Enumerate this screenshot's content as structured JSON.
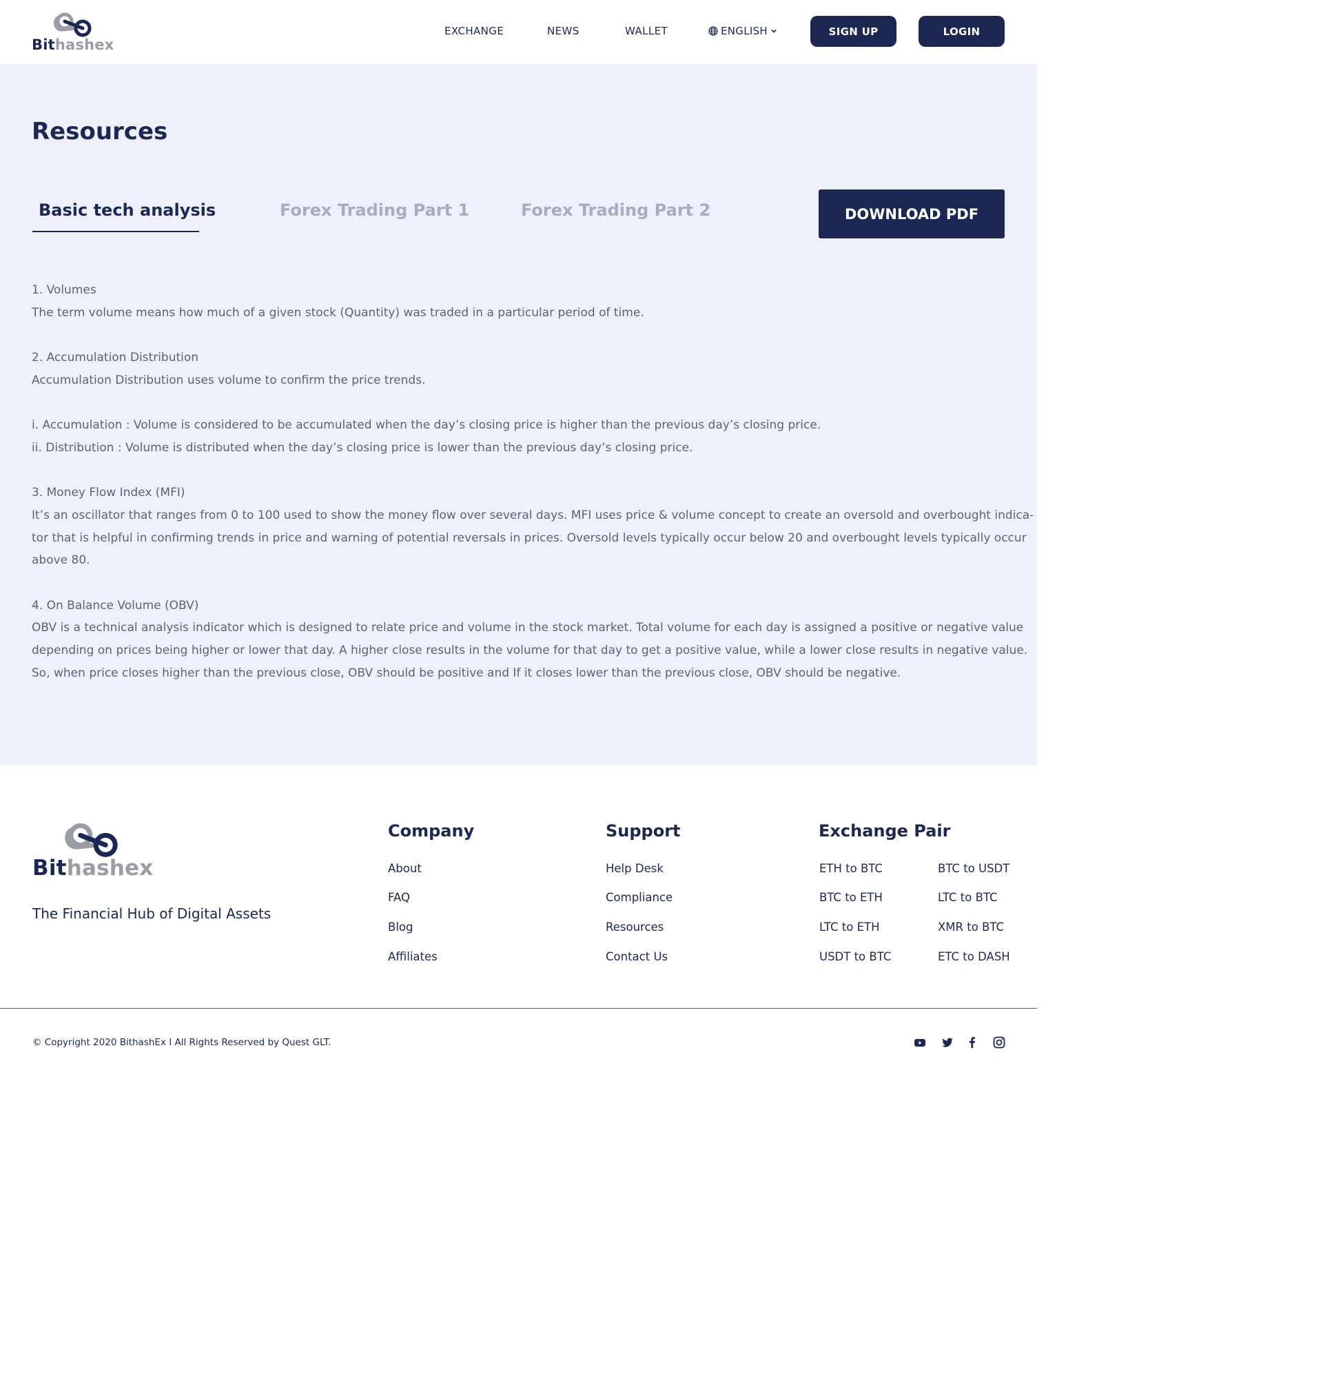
{
  "header": {
    "logo": {
      "part1": "Bit",
      "part2": "hashex"
    },
    "nav": [
      "EXCHANGE",
      "NEWS",
      "WALLET"
    ],
    "language": "ENGLISH",
    "signup_label": "SIGN UP",
    "login_label": "LOGIN"
  },
  "main": {
    "title": "Resources",
    "tabs": [
      "Basic tech analysis",
      "Forex Trading Part 1",
      "Forex Trading Part 2"
    ],
    "download_label": "DOWNLOAD PDF",
    "content": [
      "1. Volumes",
      "The term volume means how much of a given stock (Quantity) was traded in a particular period of time.",
      "",
      "2. Accumulation Distribution",
      "Accumulation Distribution uses volume to confirm the price trends.",
      "",
      "i. Accumulation : Volume is considered to be accumulated when the day’s closing price is higher than the previous day’s closing price.",
      "ii. Distribution : Volume is distributed when the day’s closing price is lower than the previous day’s closing price.",
      "",
      "3. Money Flow Index (MFI)",
      "It’s an oscillator that ranges from 0 to 100 used to show the money flow over several days. MFI uses price & volume concept to create an oversold and overbought indica-",
      "tor that is helpful in confirming trends in price and warning of potential reversals in prices. Oversold levels typically occur below 20 and overbought levels typically occur",
      "above 80.",
      "",
      "4. On Balance Volume (OBV)",
      "OBV is a technical analysis indicator which is designed to relate price and volume in the stock market. Total volume for each day is assigned a positive or negative value",
      "depending on prices being higher or lower that day. A higher close results in the volume for that day to get a positive value, while a lower close results in negative value.",
      "So, when price closes higher than the previous close, OBV should be positive and If it closes lower than the previous close, OBV should be negative."
    ]
  },
  "footer": {
    "tagline": "The Financial Hub of Digital Assets",
    "company": {
      "title": "Company",
      "links": [
        "About",
        "FAQ",
        "Blog",
        "Affiliates"
      ]
    },
    "support": {
      "title": "Support",
      "links": [
        "Help Desk",
        "Compliance",
        "Resources",
        "Contact Us"
      ]
    },
    "exchange": {
      "title": "Exchange Pair",
      "col1": [
        "ETH to BTC",
        "BTC to ETH",
        "LTC to ETH",
        "USDT to BTC"
      ],
      "col2": [
        "BTC to USDT",
        "LTC to BTC",
        "XMR to BTC",
        "ETC to DASH"
      ]
    },
    "copyright": "© Copyright 2020 BithashEx I All Rights Reserved by Quest GLT.",
    "social_icons": [
      "youtube-icon",
      "twitter-icon",
      "facebook-icon",
      "instagram-icon"
    ]
  },
  "colors": {
    "primary": "#1d2754",
    "background": "#eef0fb",
    "muted": "#a8abc2",
    "text": "#5d617a"
  }
}
